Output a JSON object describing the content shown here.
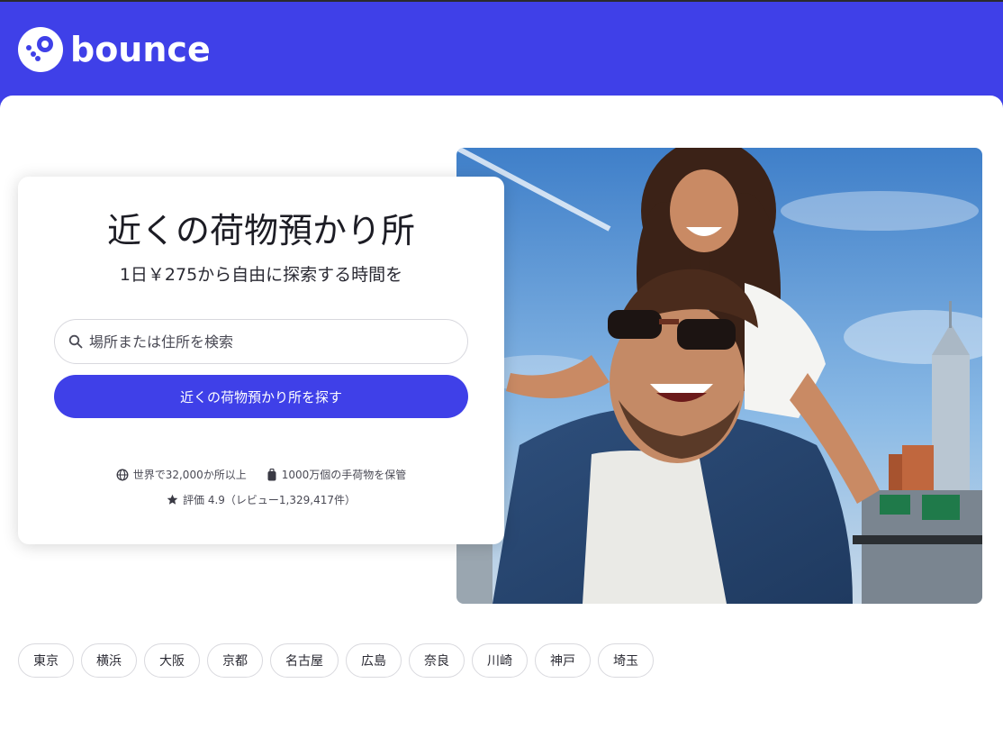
{
  "brand": {
    "name": "bounce",
    "logo_icon": "bounce-logo-icon",
    "color": "#3f40e8"
  },
  "hero": {
    "title": "近くの荷物預かり所",
    "subtitle": "1日￥275から自由に探索する時間を",
    "search_placeholder": "場所または住所を検索",
    "search_value": "",
    "cta_label": "近くの荷物預かり所を探す"
  },
  "stats": [
    {
      "icon": "globe-icon",
      "text": "世界で32,000か所以上"
    },
    {
      "icon": "luggage-icon",
      "text": "1000万個の手荷物を保管"
    },
    {
      "icon": "star-icon",
      "text": "評価 4.9（レビュー1,329,417件）"
    }
  ],
  "cities": [
    "東京",
    "横浜",
    "大阪",
    "京都",
    "名古屋",
    "広島",
    "奈良",
    "川崎",
    "神戸",
    "埼玉"
  ],
  "photo": {
    "alt": "hero-photo"
  }
}
